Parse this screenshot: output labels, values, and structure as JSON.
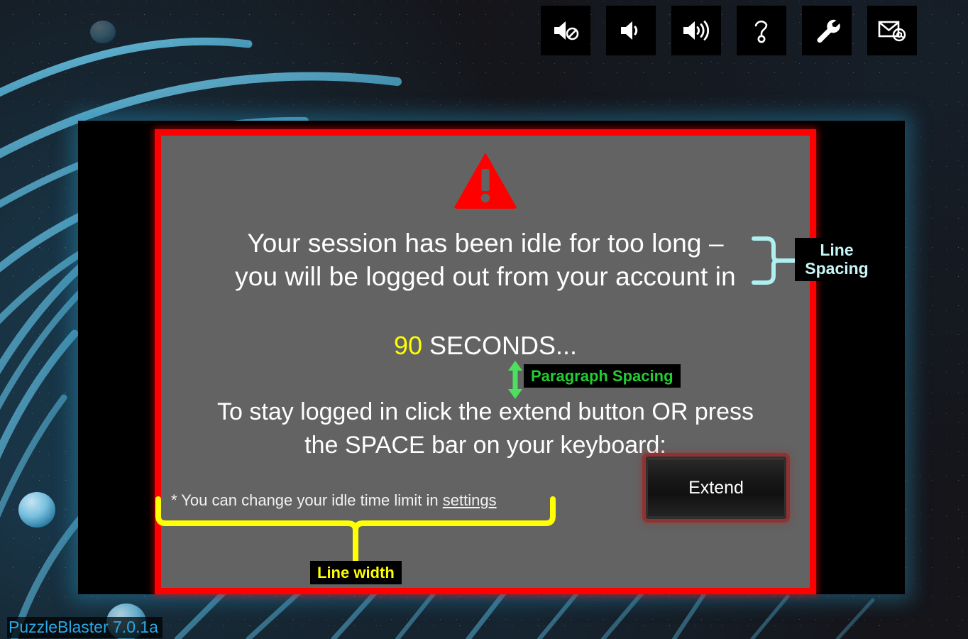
{
  "app": {
    "version_text": "PuzzleBlaster 7.0.1a"
  },
  "toolbar": {
    "buttons": [
      {
        "name": "mute-button",
        "icon": "speaker-mute-icon",
        "label": "Mute"
      },
      {
        "name": "volume-low-button",
        "icon": "speaker-low-icon",
        "label": "Volume low"
      },
      {
        "name": "volume-high-button",
        "icon": "speaker-high-icon",
        "label": "Volume high"
      },
      {
        "name": "help-button",
        "icon": "question-mark-icon",
        "label": "Help"
      },
      {
        "name": "settings-button",
        "icon": "wrench-icon",
        "label": "Settings"
      },
      {
        "name": "contact-button",
        "icon": "envelope-at-icon",
        "label": "Contact"
      }
    ]
  },
  "dialog": {
    "warning_icon": "warning-triangle-icon",
    "message_line_1": "Your session has been idle for too long –",
    "message_line_2": "you will be logged out from your account in",
    "countdown_value": "90",
    "countdown_unit": "SECONDS...",
    "instruction_line_1": " To stay logged in click the extend button OR press",
    "instruction_line_2": "the SPACE bar on your keyboard:",
    "footnote_prefix": "* You can change your idle time limit in ",
    "footnote_link": "settings",
    "extend_button_label": "Extend"
  },
  "annotations": {
    "line_spacing": "Line\nSpacing",
    "paragraph_spacing": "Paragraph Spacing",
    "line_width": "Line width"
  },
  "colors": {
    "dialog_border": "#ff0000",
    "dialog_bg": "#636363",
    "countdown_accent": "#ffff00",
    "line_spacing_accent": "#c9f6f6",
    "paragraph_spacing_accent": "#22cc33",
    "line_width_accent": "#ffff00",
    "version_text": "#29a9e8",
    "background_glow": "#2896c3"
  }
}
